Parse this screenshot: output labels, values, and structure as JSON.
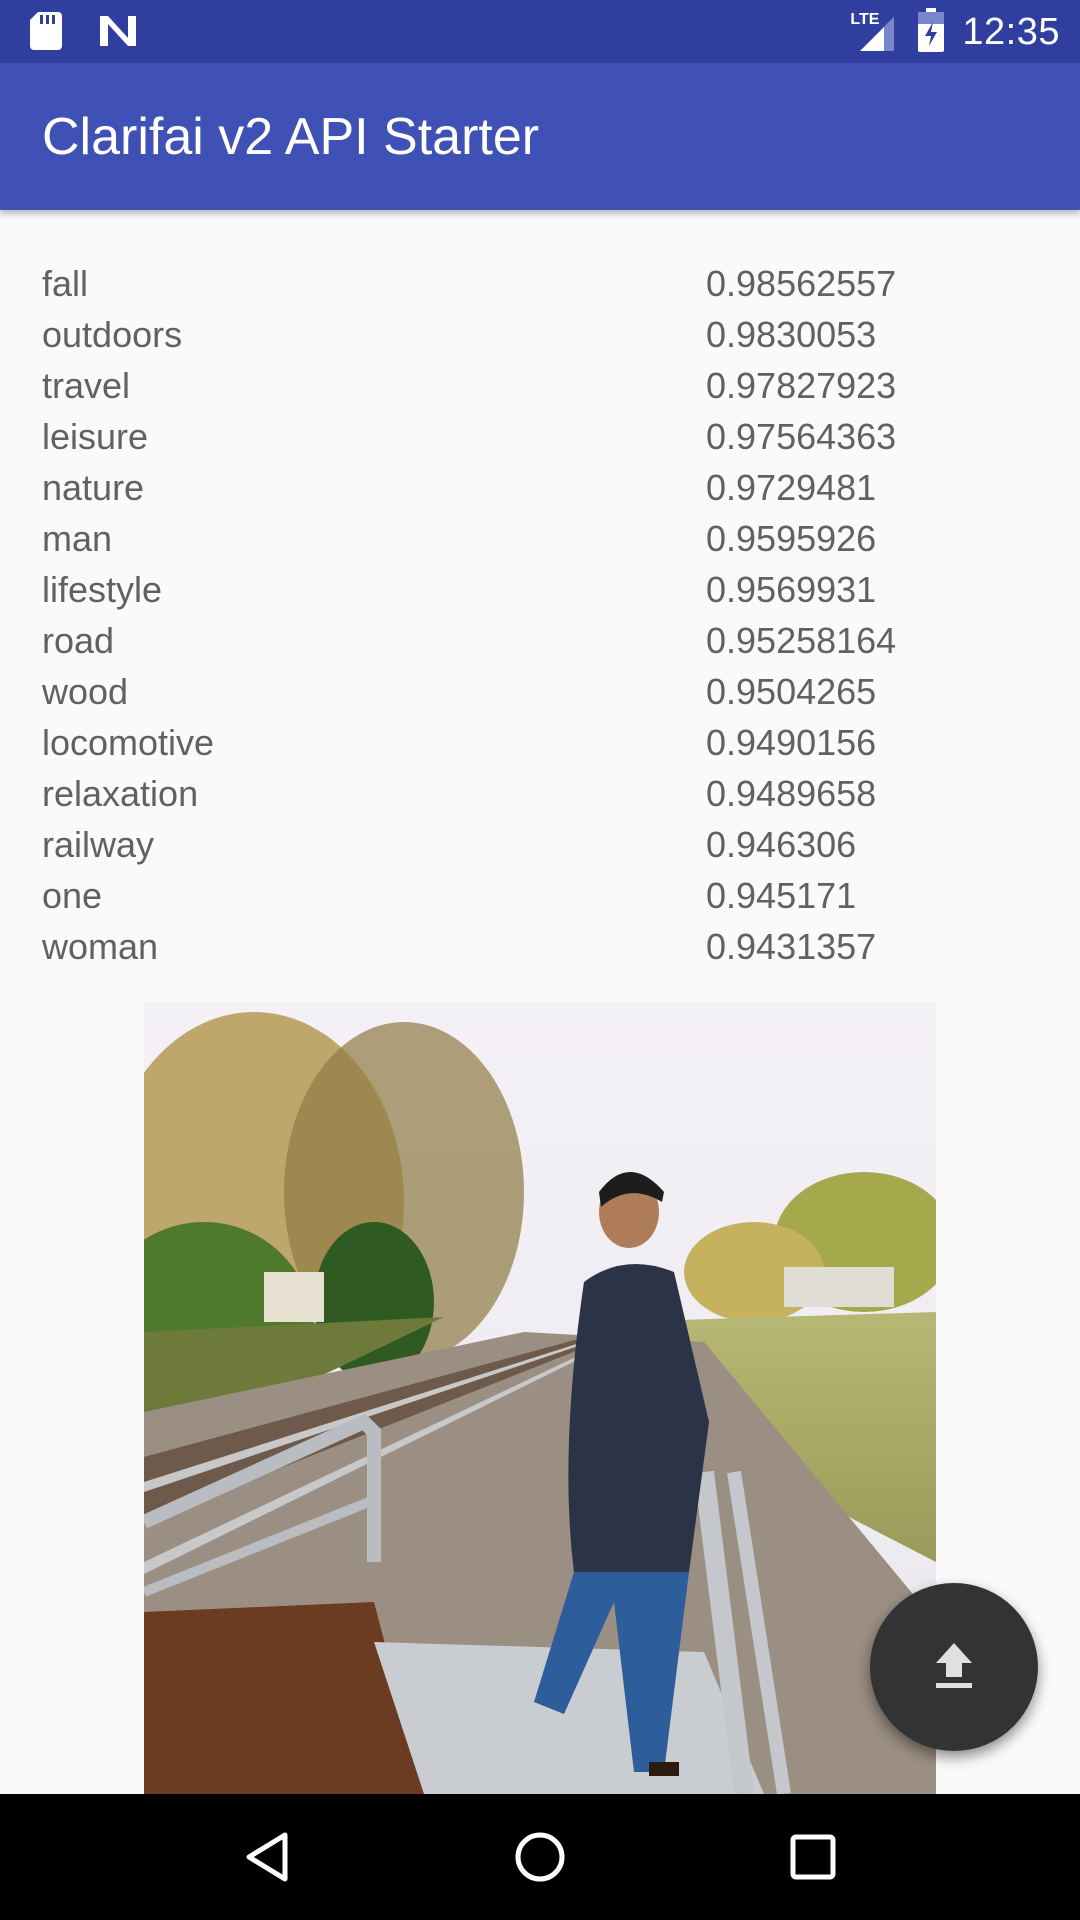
{
  "status_bar": {
    "time": "12:35",
    "network_label": "LTE",
    "icons": [
      "sd-card-icon",
      "n-logo-icon",
      "lte-signal-icon",
      "battery-charging-icon"
    ]
  },
  "app_bar": {
    "title": "Clarifai v2 API Starter"
  },
  "tags": [
    {
      "name": "fall",
      "value": "0.98562557"
    },
    {
      "name": "outdoors",
      "value": "0.9830053"
    },
    {
      "name": "travel",
      "value": "0.97827923"
    },
    {
      "name": "leisure",
      "value": "0.97564363"
    },
    {
      "name": "nature",
      "value": "0.9729481"
    },
    {
      "name": "man",
      "value": "0.9595926"
    },
    {
      "name": "lifestyle",
      "value": "0.9569931"
    },
    {
      "name": "road",
      "value": "0.95258164"
    },
    {
      "name": "wood",
      "value": "0.9504265"
    },
    {
      "name": "locomotive",
      "value": "0.9490156"
    },
    {
      "name": "relaxation",
      "value": "0.9489658"
    },
    {
      "name": "railway",
      "value": "0.946306"
    },
    {
      "name": "one",
      "value": "0.945171"
    },
    {
      "name": "woman",
      "value": "0.9431357"
    }
  ],
  "fab": {
    "icon": "upload-icon"
  },
  "nav_bar": {
    "icons": [
      "back-icon",
      "home-icon",
      "recents-icon"
    ]
  },
  "colors": {
    "status_bar": "#303f9f",
    "app_bar": "#3f51b5",
    "fab": "#333333",
    "text_secondary": "#616161"
  }
}
